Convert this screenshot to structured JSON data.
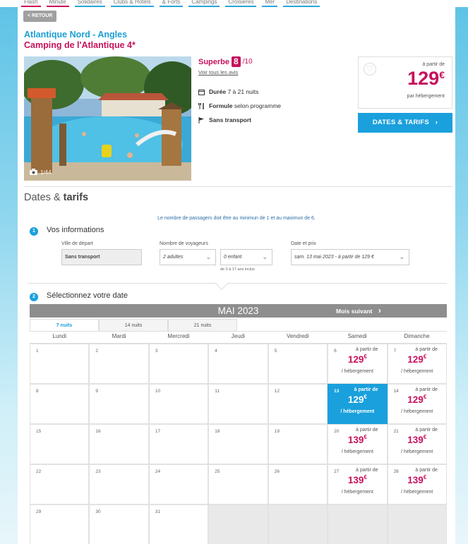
{
  "nav": {
    "items": [
      "Flash",
      "Minute",
      "Solidaires",
      "Clubs & Hôtels",
      "& Forts",
      "Campings",
      "Croisières",
      "Mer",
      "Destinations"
    ]
  },
  "header": {
    "back_label": "< RETOUR",
    "region": "Atlantique Nord - Angles",
    "camp_name": "Camping de l'Atlantique 4*"
  },
  "photo": {
    "counter": "1/44"
  },
  "rating": {
    "label": "Superbe",
    "score": "8",
    "denominator": "/10",
    "reviews_link": "Voir tous les avis"
  },
  "features": [
    {
      "icon": "calendar-icon",
      "strong": "Durée",
      "text": " 7 à 21 nuits"
    },
    {
      "icon": "cutlery-icon",
      "strong": "Formule",
      "text": " selon programme"
    },
    {
      "icon": "flag-icon",
      "strong": "",
      "text": "Sans transport"
    }
  ],
  "price_box": {
    "from": "à partir de",
    "price": "129",
    "currency": "€",
    "per": "par hébergement"
  },
  "dates_button": "DATES & TARIFS",
  "section": {
    "title_prefix": "Dates & ",
    "title_bold": "tarifs"
  },
  "info_line": "Le nombre de passagers doit être au minimun de 1 et au maximun de 6.",
  "step1": {
    "num": "1",
    "title": "Vos informations",
    "departure_label": "Ville de départ",
    "departure_value": "Sans transport",
    "travellers_label": "Nombre de voyageurs",
    "adults_value": "2 adultes",
    "children_value": "0 enfant",
    "children_note": "de 0 à 17 ans inclus",
    "date_label": "Date et prix",
    "date_value": "sam. 13 mai 2023 - à partir de 129 €"
  },
  "step2": {
    "num": "2",
    "title": "Sélectionnez votre date"
  },
  "calendar": {
    "month": "MAI 2023",
    "next_month": "Mois suivant",
    "tabs": [
      "7 nuits",
      "14 nuits",
      "21 nuits"
    ],
    "weekdays": [
      "Lundi",
      "Mardi",
      "Mercredi",
      "Jeudi",
      "Vendredi",
      "Samedi",
      "Dimanche"
    ],
    "from_label": "à partir de",
    "per_label": "/ hébergement",
    "currency": "€",
    "days": [
      {
        "d": "1"
      },
      {
        "d": "2"
      },
      {
        "d": "3"
      },
      {
        "d": "4"
      },
      {
        "d": "5"
      },
      {
        "d": "6",
        "price": "129"
      },
      {
        "d": "7",
        "price": "129"
      },
      {
        "d": "8"
      },
      {
        "d": "9"
      },
      {
        "d": "10"
      },
      {
        "d": "11"
      },
      {
        "d": "12"
      },
      {
        "d": "13",
        "price": "129",
        "selected": true
      },
      {
        "d": "14",
        "price": "129"
      },
      {
        "d": "15"
      },
      {
        "d": "16"
      },
      {
        "d": "17"
      },
      {
        "d": "18"
      },
      {
        "d": "19"
      },
      {
        "d": "20",
        "price": "139"
      },
      {
        "d": "21",
        "price": "139"
      },
      {
        "d": "22"
      },
      {
        "d": "23"
      },
      {
        "d": "24"
      },
      {
        "d": "25"
      },
      {
        "d": "26"
      },
      {
        "d": "27",
        "price": "139"
      },
      {
        "d": "28",
        "price": "139"
      },
      {
        "d": "29"
      },
      {
        "d": "30"
      },
      {
        "d": "31"
      },
      {
        "d": ""
      },
      {
        "d": ""
      },
      {
        "d": ""
      },
      {
        "d": ""
      }
    ]
  },
  "colors": {
    "accent_blue": "#1aa0dc",
    "brand_pink": "#c7115c"
  }
}
